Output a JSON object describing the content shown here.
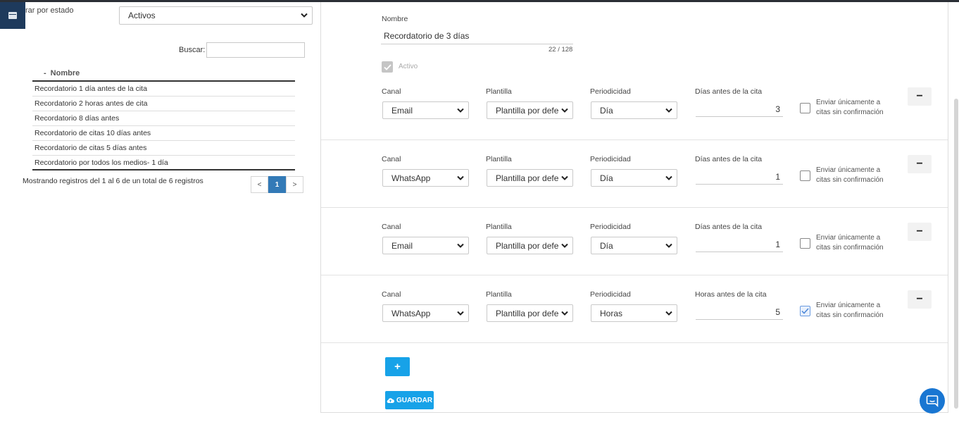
{
  "filter": {
    "label": "rar por estado",
    "selected": "Activos"
  },
  "search": {
    "label": "Buscar:",
    "value": ""
  },
  "list": {
    "header": "Nombre",
    "sort_indicator": "-",
    "rows": [
      "Recordatorio 1 día antes de la cita",
      "Recordatorio 2 horas antes de cita",
      "Recordatorio 8 días antes",
      "Recordatorio de citas 10 días antes",
      "Recordatorio de citas 5 días antes",
      "Recordatorio por todos los medios- 1 día"
    ],
    "info": "Mostrando registros del 1 al 6 de un total de 6 registros",
    "pager": {
      "prev": "<",
      "current": "1",
      "next": ">"
    }
  },
  "form": {
    "name_label": "Nombre",
    "name_value": "Recordatorio de 3 días",
    "counter": "22 / 128",
    "active_label": "Activo",
    "active_checked": true,
    "col_labels": {
      "canal": "Canal",
      "plantilla": "Plantilla",
      "periodicidad": "Periodicidad"
    },
    "checkbox_label": "Enviar únicamente a citas sin confirmación",
    "rules": [
      {
        "canal": "Email",
        "plantilla": "Plantilla por defe",
        "periodicidad": "Día",
        "amount_label": "Días antes de la cita",
        "amount": "3",
        "only_unconfirmed": false
      },
      {
        "canal": "WhatsApp",
        "plantilla": "Plantilla por defe",
        "periodicidad": "Día",
        "amount_label": "Días antes de la cita",
        "amount": "1",
        "only_unconfirmed": false
      },
      {
        "canal": "Email",
        "plantilla": "Plantilla por defe",
        "periodicidad": "Día",
        "amount_label": "Días antes de la cita",
        "amount": "1",
        "only_unconfirmed": false
      },
      {
        "canal": "WhatsApp",
        "plantilla": "Plantilla por defe",
        "periodicidad": "Horas",
        "amount_label": "Horas antes de la cita",
        "amount": "5",
        "only_unconfirmed": true
      }
    ],
    "remove_label": "−",
    "add_label": "+",
    "save_label": "GUARDAR"
  },
  "colors": {
    "primary": "#17a2e8",
    "pager_active": "#337ab7",
    "menu": "#1e3a5c",
    "chat": "#1976d2"
  }
}
